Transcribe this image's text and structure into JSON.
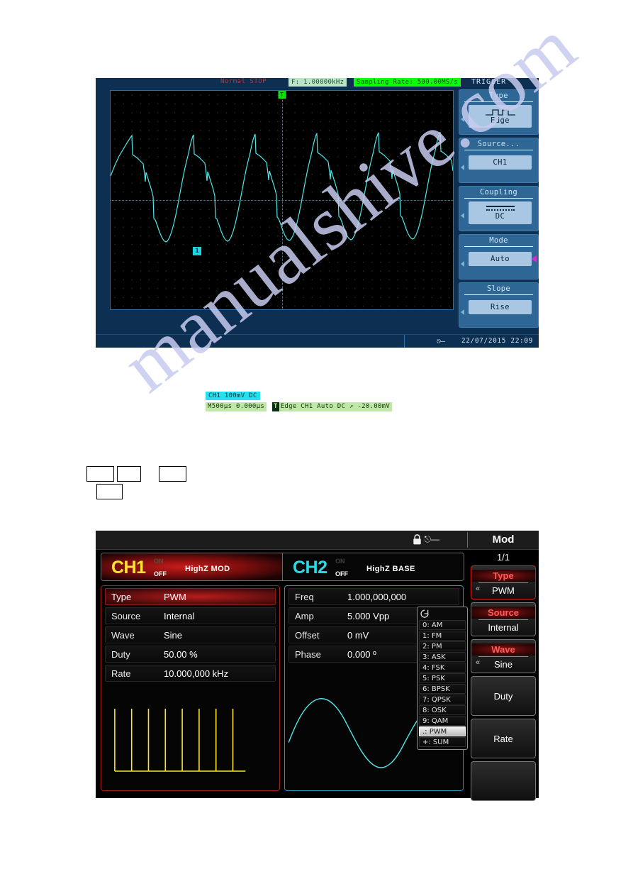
{
  "watermark": {
    "text": "manualshive.com"
  },
  "scope": {
    "status": {
      "acq_mode": "Normal STOP",
      "frequency": "F: 1.00000kHz",
      "sampling_rate": "Sampling Rate:  500.00MS/s",
      "panel_title": "TRIGGER"
    },
    "markers": {
      "trigger_position": "T",
      "channel_marker": "1"
    },
    "labels": {
      "channel_scale": "CH1  100mV  DC",
      "timebase": "M500µs 0.000µs",
      "trigger_badge": "T",
      "trigger_info": "Edge CH1 Auto DC ↗ -20.00mV"
    },
    "datetime": "22/07/2015  22:09",
    "trigger_menu": [
      {
        "title": "Type",
        "value": "Edge",
        "icon": "edge-pulse-icon"
      },
      {
        "title": "Source...",
        "value": "CH1",
        "icon": ""
      },
      {
        "title": "Coupling",
        "value": "DC",
        "icon": "dc-coupling-icon"
      },
      {
        "title": "Mode",
        "value": "Auto",
        "icon": ""
      },
      {
        "title": "Slope",
        "value": "Rise",
        "icon": ""
      }
    ]
  },
  "generator": {
    "header": {
      "title": "Mod",
      "lock_icon": "lock-icon",
      "usb_icon": "usb-icon"
    },
    "channels": [
      {
        "name": "CH1",
        "on": "ON",
        "off": "OFF",
        "mode": "HighZ MOD"
      },
      {
        "name": "CH2",
        "on": "ON",
        "off": "OFF",
        "mode": "HighZ BASE"
      }
    ],
    "left_params": [
      {
        "key": "Type",
        "value": "PWM",
        "active": true
      },
      {
        "key": "Source",
        "value": "Internal",
        "active": false
      },
      {
        "key": "Wave",
        "value": "Sine",
        "active": false
      },
      {
        "key": "Duty",
        "value": "50.00 %",
        "active": false
      },
      {
        "key": "Rate",
        "value": "10.000,000 kHz",
        "active": false
      }
    ],
    "right_params": [
      {
        "key": "Freq",
        "value": "1.000,000,000"
      },
      {
        "key": "Amp",
        "value": "5.000 Vpp"
      },
      {
        "key": "Offset",
        "value": "0 mV"
      },
      {
        "key": "Phase",
        "value": "0.000 º"
      }
    ],
    "dropdown": {
      "refresh_icon": "refresh-icon",
      "items": [
        "0: AM",
        "1: FM",
        "2: PM",
        "3: ASK",
        "4: FSK",
        "5: PSK",
        "6: BPSK",
        "7: QPSK",
        "8: OSK",
        "9: QAM",
        ".: PWM",
        "+: SUM"
      ],
      "selected": ".: PWM"
    },
    "softkeys": {
      "page": "1/1",
      "buttons": [
        {
          "label": "Type",
          "value": "PWM",
          "selected": true,
          "caret": "«"
        },
        {
          "label": "Source",
          "value": "Internal",
          "selected": false,
          "caret": ""
        },
        {
          "label": "Wave",
          "value": "Sine",
          "selected": false,
          "caret": "«"
        },
        {
          "label": "Duty",
          "value": "",
          "selected": false,
          "caret": ""
        },
        {
          "label": "Rate",
          "value": "",
          "selected": false,
          "caret": ""
        },
        {
          "label": "",
          "value": "",
          "selected": false,
          "caret": ""
        }
      ]
    }
  },
  "colors": {
    "ch1": "#ffe52e",
    "ch2": "#27dbe8",
    "scope_trace": "#4fe8e8",
    "accent_red": "#cf2020",
    "scope_bg": "#0d2f52"
  }
}
